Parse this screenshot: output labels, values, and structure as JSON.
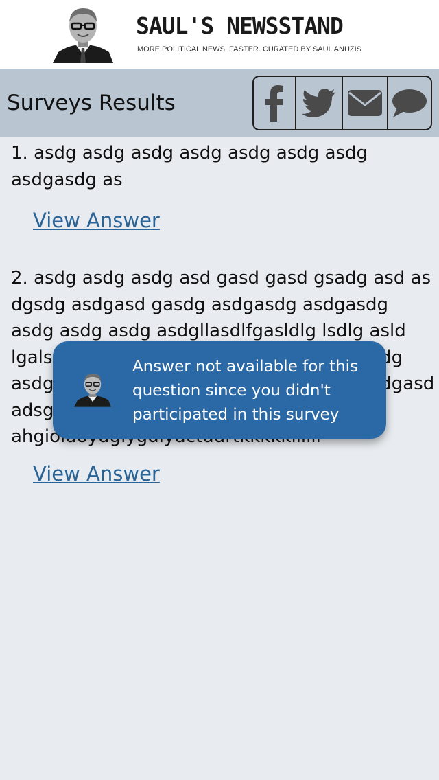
{
  "header": {
    "brand_title": "SAUL'S NEWSSTAND",
    "brand_subtitle": "MORE POLITICAL NEWS, FASTER. CURATED BY SAUL ANUZIS"
  },
  "titlebar": {
    "title": "Surveys Results",
    "share": [
      {
        "icon": "facebook-icon"
      },
      {
        "icon": "twitter-icon"
      },
      {
        "icon": "email-icon"
      },
      {
        "icon": "chat-icon"
      }
    ]
  },
  "questions": [
    {
      "text": "1. asdg asdg asdg asdg asdg asdg asdg asdgasdg as",
      "link_label": "View Answer"
    },
    {
      "text": "2. asdg asdg asdg asd gasd gasd gsadg asd as dgsdg asdgasd gasdg asdgasdg asdgasdg asdg asdg asdg asdgllasdlfgasldlg lsdlg asld lgalsdgl asdgasdgasdgasdg asdg asdg asdg asdgsg asdgasdgasdg asdg asdg asdg asdgasd adsgasdg asdg asdg asdg ahgioldoydgiygdiydctddrtkkkkkllllll",
      "link_label": "View Answer"
    }
  ],
  "toast": {
    "message": "Answer not available for this question since you didn't participated in this survey"
  },
  "colors": {
    "titlebar_bg": "#b9c6d2",
    "page_bg": "#e8ecf0",
    "toast_bg": "#2a69a5",
    "link": "#2a6496",
    "icon": "#4a4a4a"
  }
}
